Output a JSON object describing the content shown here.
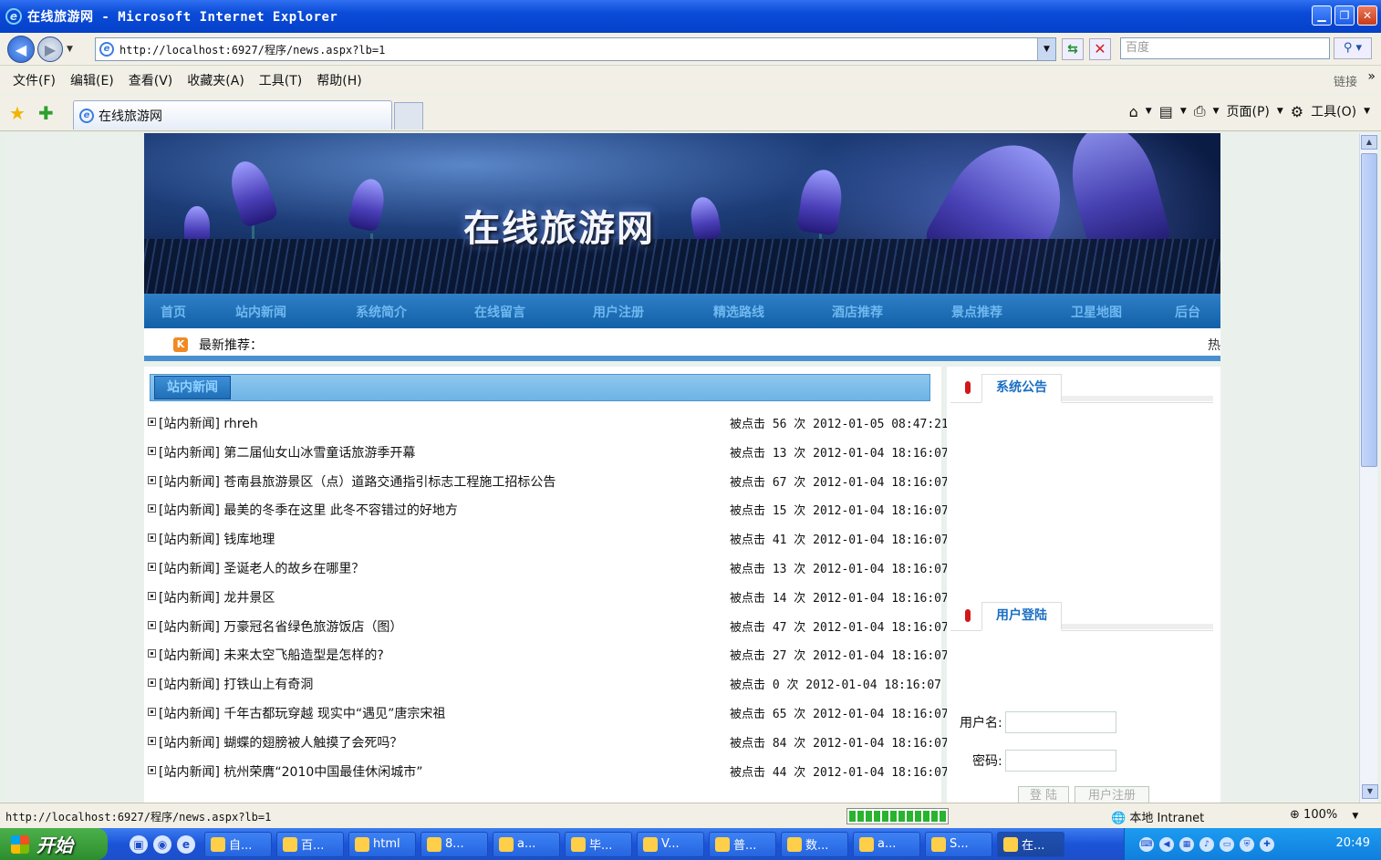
{
  "window": {
    "title": "在线旅游网 - Microsoft Internet Explorer",
    "min_glyph": "▁",
    "max_glyph": "❐",
    "close_glyph": "✕"
  },
  "address_bar": {
    "url": "http://localhost:6927/程序/news.aspx?lb=1",
    "search_placeholder": "百度"
  },
  "menu": {
    "items": [
      "文件(F)",
      "编辑(E)",
      "查看(V)",
      "收藏夹(A)",
      "工具(T)",
      "帮助(H)"
    ],
    "links_label": "链接"
  },
  "tabs": {
    "active_label": "在线旅游网"
  },
  "command_bar": {
    "page_label": "页面(P)",
    "tools_label": "工具(O)"
  },
  "banner": {
    "site_title": "在线旅游网"
  },
  "site_nav": {
    "items": [
      "首页",
      "站内新闻",
      "系统简介",
      "在线留言",
      "用户注册",
      "精选路线",
      "酒店推荐",
      "景点推荐",
      "卫星地图",
      "后台"
    ]
  },
  "ticker": {
    "icon_text": "K",
    "label": "最新推荐：",
    "trailing": "热"
  },
  "news": {
    "header": "站内新闻",
    "items": [
      {
        "title": "[站内新闻] rhreh",
        "meta": "被点击 56 次 2012-01-05 08:47:21"
      },
      {
        "title": "[站内新闻] 第二届仙女山冰雪童话旅游季开幕",
        "meta": "被点击 13 次 2012-01-04 18:16:07"
      },
      {
        "title": "[站内新闻] 苍南县旅游景区（点）道路交通指引标志工程施工招标公告",
        "meta": "被点击 67 次 2012-01-04 18:16:07"
      },
      {
        "title": "[站内新闻] 最美的冬季在这里 此冬不容错过的好地方",
        "meta": "被点击 15 次 2012-01-04 18:16:07"
      },
      {
        "title": "[站内新闻] 钱库地理",
        "meta": "被点击 41 次 2012-01-04 18:16:07"
      },
      {
        "title": "[站内新闻] 圣诞老人的故乡在哪里？",
        "meta": "被点击 13 次 2012-01-04 18:16:07"
      },
      {
        "title": "[站内新闻] 龙井景区",
        "meta": "被点击 14 次 2012-01-04 18:16:07"
      },
      {
        "title": "[站内新闻] 万豪冠名省绿色旅游饭店（图）",
        "meta": "被点击 47 次 2012-01-04 18:16:07"
      },
      {
        "title": "[站内新闻] 未来太空飞船造型是怎样的?",
        "meta": "被点击 27 次 2012-01-04 18:16:07"
      },
      {
        "title": "[站内新闻] 打铁山上有奇洞",
        "meta": "被点击 0 次  2012-01-04 18:16:07"
      },
      {
        "title": "[站内新闻] 千年古都玩穿越 现实中“遇见”唐宗宋祖",
        "meta": "被点击 65 次 2012-01-04 18:16:07"
      },
      {
        "title": "[站内新闻] 蝴蝶的翅膀被人触摸了会死吗？",
        "meta": "被点击 84 次 2012-01-04 18:16:07"
      },
      {
        "title": "[站内新闻] 杭州荣膺“2010中国最佳休闲城市”",
        "meta": "被点击 44 次 2012-01-04 18:16:07"
      }
    ]
  },
  "sidebar": {
    "notice_title": "系统公告",
    "login_title": "用户登陆",
    "username_label": "用户名:",
    "password_label": "密码:",
    "login_button": "登 陆",
    "register_button": "用户注册"
  },
  "status": {
    "url": "http://localhost:6927/程序/news.aspx?lb=1",
    "zone": "本地 Intranet",
    "zoom": "100%",
    "progress_fraction": 1.0
  },
  "taskbar": {
    "start_label": "开始",
    "tasks": [
      "自...",
      "百...",
      "html",
      "8...",
      "a...",
      "毕...",
      "V...",
      "普...",
      "数...",
      "a...",
      "S...",
      "在..."
    ],
    "clock": "20:49"
  }
}
